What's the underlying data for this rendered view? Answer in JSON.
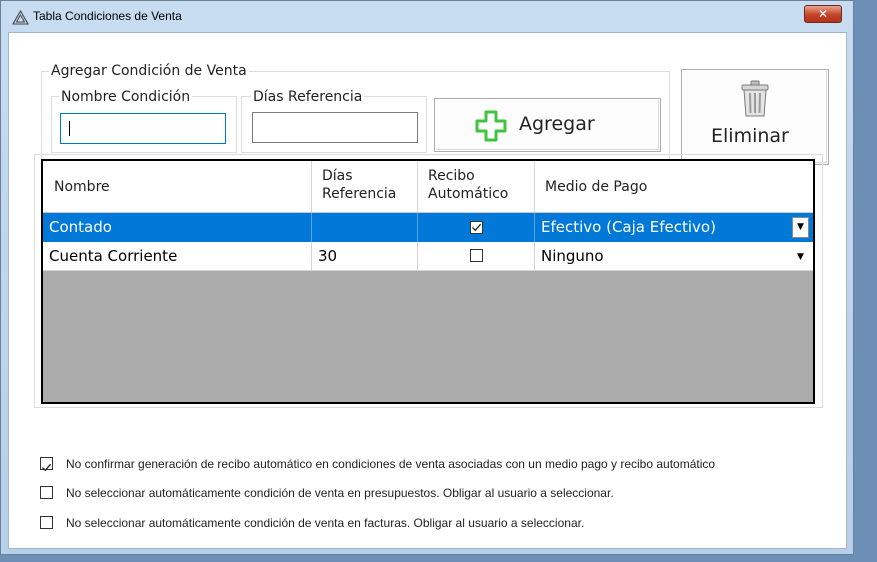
{
  "window": {
    "title": "Tabla Condiciones de Venta",
    "close_label": "✕"
  },
  "add_group": {
    "title": "Agregar Condición de Venta",
    "name_field": {
      "label": "Nombre Condición",
      "value": ""
    },
    "days_field": {
      "label": "Días Referencia",
      "value": ""
    },
    "add_button": "Agregar",
    "delete_button": "Eliminar"
  },
  "grid": {
    "columns": [
      {
        "line1": "Nombre",
        "line2": ""
      },
      {
        "line1": "Días",
        "line2": "Referencia"
      },
      {
        "line1": "Recibo",
        "line2": "Automático"
      },
      {
        "line1": "Medio de Pago",
        "line2": ""
      }
    ],
    "rows": [
      {
        "nombre": "Contado",
        "dias": "",
        "recibo_automatico": true,
        "medio_pago": "Efectivo (Caja Efectivo)",
        "selected": true
      },
      {
        "nombre": "Cuenta Corriente",
        "dias": "30",
        "recibo_automatico": false,
        "medio_pago": "Ninguno",
        "selected": false
      }
    ]
  },
  "options": [
    {
      "label": "No confirmar generación de recibo automático en condiciones de venta asociadas con un medio pago y recibo automático",
      "checked": true
    },
    {
      "label": "No seleccionar automáticamente condición de venta en presupuestos. Obligar al usuario a seleccionar.",
      "checked": false
    },
    {
      "label": "No seleccionar automáticamente condición de venta en facturas. Obligar al usuario a seleccionar.",
      "checked": false
    }
  ],
  "colors": {
    "selection": "#0078d7",
    "grid_empty": "#ababab",
    "add_icon": "#3ec43e"
  },
  "icons": {
    "title": "triangle-app-icon",
    "add": "plus-icon",
    "delete": "trash-can-icon"
  }
}
